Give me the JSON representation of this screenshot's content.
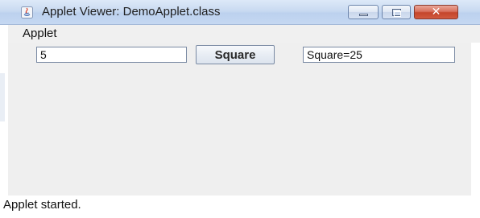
{
  "window": {
    "title": "Applet Viewer: DemoApplet.class",
    "app_icon": "java-icon",
    "controls": {
      "minimize_icon": "minimize-icon",
      "maximize_icon": "maximize-icon",
      "close_icon": "close-icon",
      "close_glyph": "✕"
    }
  },
  "menu": {
    "applet_label": "Applet"
  },
  "applet": {
    "number_input_value": "5",
    "square_button_label": "Square",
    "result_value": "Square=25"
  },
  "status": {
    "text": "Applet started."
  },
  "colors": {
    "titlebar": "#c9daf1",
    "content_bg": "#efefef",
    "close_button": "#c4452b"
  }
}
